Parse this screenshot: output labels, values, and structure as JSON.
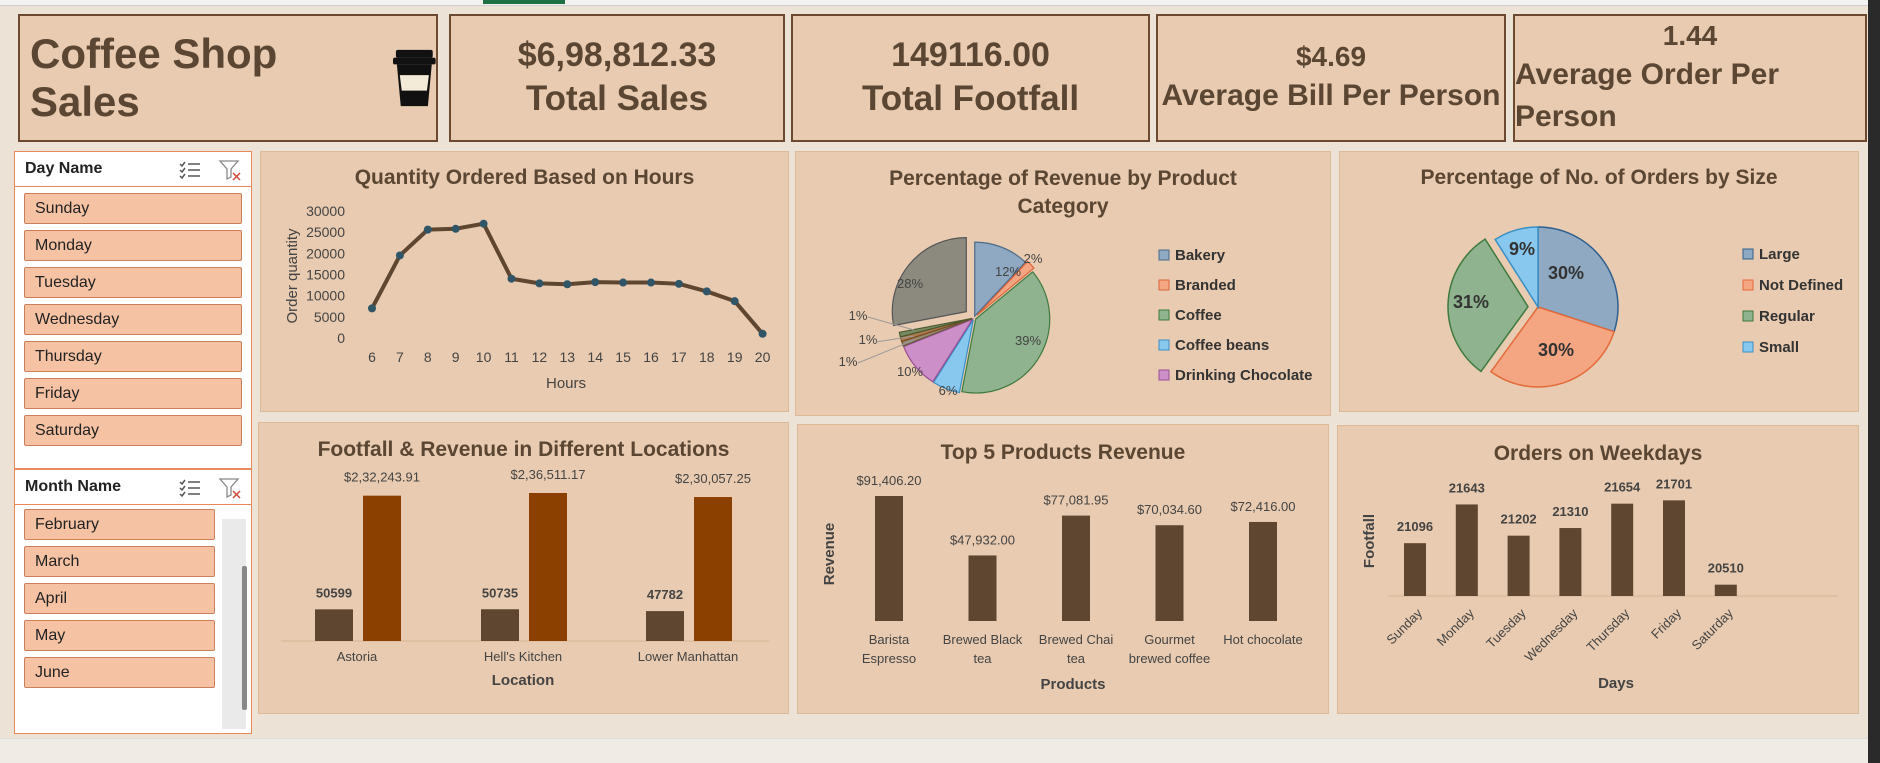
{
  "dashboard": {
    "title": "Coffee Shop Sales",
    "kpis": [
      {
        "value": "$6,98,812.33",
        "label": "Total Sales"
      },
      {
        "value": "149116.00",
        "label": "Total Footfall"
      },
      {
        "value": "$4.69",
        "label": "Average Bill Per Person"
      },
      {
        "value": "1.44",
        "label": "Average Order Per Person"
      }
    ]
  },
  "slicers": {
    "day": {
      "header": "Day Name",
      "items": [
        "Sunday",
        "Monday",
        "Tuesday",
        "Wednesday",
        "Thursday",
        "Friday",
        "Saturday"
      ]
    },
    "month": {
      "header": "Month Name",
      "items": [
        "February",
        "March",
        "April",
        "May",
        "June"
      ]
    }
  },
  "colors": {
    "panel": "#e8cbb0",
    "line": "#5e4630",
    "dark_bar": "#5e4630",
    "orange_bar": "#8b4000",
    "bakery": "#8ea9c1",
    "branded": "#f4a582",
    "coffee": "#8fb28f",
    "coffee_beans": "#88c8ee",
    "drinking_chocolate": "#cc8fc8",
    "other_slice": "#8c8a7e"
  },
  "chart_data": [
    {
      "type": "line",
      "title": "Quantity Ordered Based on Hours",
      "xlabel": "Hours",
      "ylabel": "Order quantity",
      "x": [
        6,
        7,
        8,
        9,
        10,
        11,
        12,
        13,
        14,
        15,
        16,
        17,
        18,
        19,
        20
      ],
      "values": [
        7000,
        19500,
        25600,
        25800,
        27000,
        14000,
        12900,
        12700,
        13200,
        13100,
        13100,
        12800,
        11000,
        8700,
        1000
      ],
      "ylim": [
        0,
        30000
      ],
      "yticks": [
        "0",
        "5000",
        "10000",
        "15000",
        "20000",
        "25000",
        "30000"
      ],
      "xticks": [
        "6",
        "7",
        "8",
        "9",
        "10",
        "11",
        "12",
        "13",
        "14",
        "15",
        "16",
        "17",
        "18",
        "19",
        "20"
      ]
    },
    {
      "type": "pie",
      "title": "Percentage of Revenue by Product Category",
      "title_lines": [
        "Percentage of Revenue by Product",
        "Category"
      ],
      "categories": [
        "Bakery",
        "Branded",
        "Coffee",
        "Coffee beans",
        "Drinking Chocolate",
        "1%",
        "1%",
        "1%",
        "28%"
      ],
      "values": [
        12,
        2,
        39,
        6,
        10,
        1,
        1,
        1,
        28
      ],
      "labels": [
        "12%",
        "2%",
        "39%",
        "6%",
        "10%",
        "1%",
        "1%",
        "1%",
        "28%"
      ],
      "legend": [
        "Bakery",
        "Branded",
        "Coffee",
        "Coffee beans",
        "Drinking Chocolate"
      ],
      "legend_position": "right"
    },
    {
      "type": "pie",
      "title": "Percentage of No. of Orders by Size",
      "categories": [
        "Large",
        "Not Defined",
        "Regular",
        "Small"
      ],
      "values": [
        30,
        30,
        31,
        9
      ],
      "labels": [
        "30%",
        "30%",
        "31%",
        "9%"
      ],
      "legend": [
        "Large",
        "Not Defined",
        "Regular",
        "Small"
      ],
      "legend_position": "right"
    },
    {
      "type": "bar",
      "title": "Footfall & Revenue in Different Locations",
      "xlabel": "Location",
      "categories": [
        "Astoria",
        "Hell's Kitchen",
        "Lower Manhattan"
      ],
      "footfall": [
        50599,
        50735,
        47782
      ],
      "footfall_labels": [
        "50599",
        "50735",
        "47782"
      ],
      "revenue": [
        232243.91,
        236511.17,
        230057.25
      ],
      "revenue_labels": [
        "$2,32,243.91",
        "$2,36,511.17",
        "$2,30,057.25"
      ]
    },
    {
      "type": "bar",
      "title": "Top 5 Products Revenue",
      "xlabel": "Products",
      "ylabel": "Revenue",
      "categories": [
        [
          "Barista",
          "Espresso"
        ],
        [
          "Brewed Black",
          "tea"
        ],
        [
          "Brewed Chai",
          "tea"
        ],
        [
          "Gourmet",
          "brewed coffee"
        ],
        [
          "Hot chocolate"
        ]
      ],
      "values": [
        91406.2,
        47932.0,
        77081.95,
        70034.6,
        72416.0
      ],
      "value_labels": [
        "$91,406.20",
        "$47,932.00",
        "$77,081.95",
        "$70,034.60",
        "$72,416.00"
      ]
    },
    {
      "type": "bar",
      "title": "Orders on Weekdays",
      "xlabel": "Days",
      "ylabel": "Footfall",
      "categories": [
        "Sunday",
        "Monday",
        "Tuesday",
        "Wednesday",
        "Thursday",
        "Friday",
        "Saturday"
      ],
      "values": [
        21096,
        21643,
        21202,
        21310,
        21654,
        21701,
        20510
      ],
      "value_labels": [
        "21096",
        "21643",
        "21202",
        "21310",
        "21654",
        "21701",
        "20510"
      ]
    }
  ]
}
